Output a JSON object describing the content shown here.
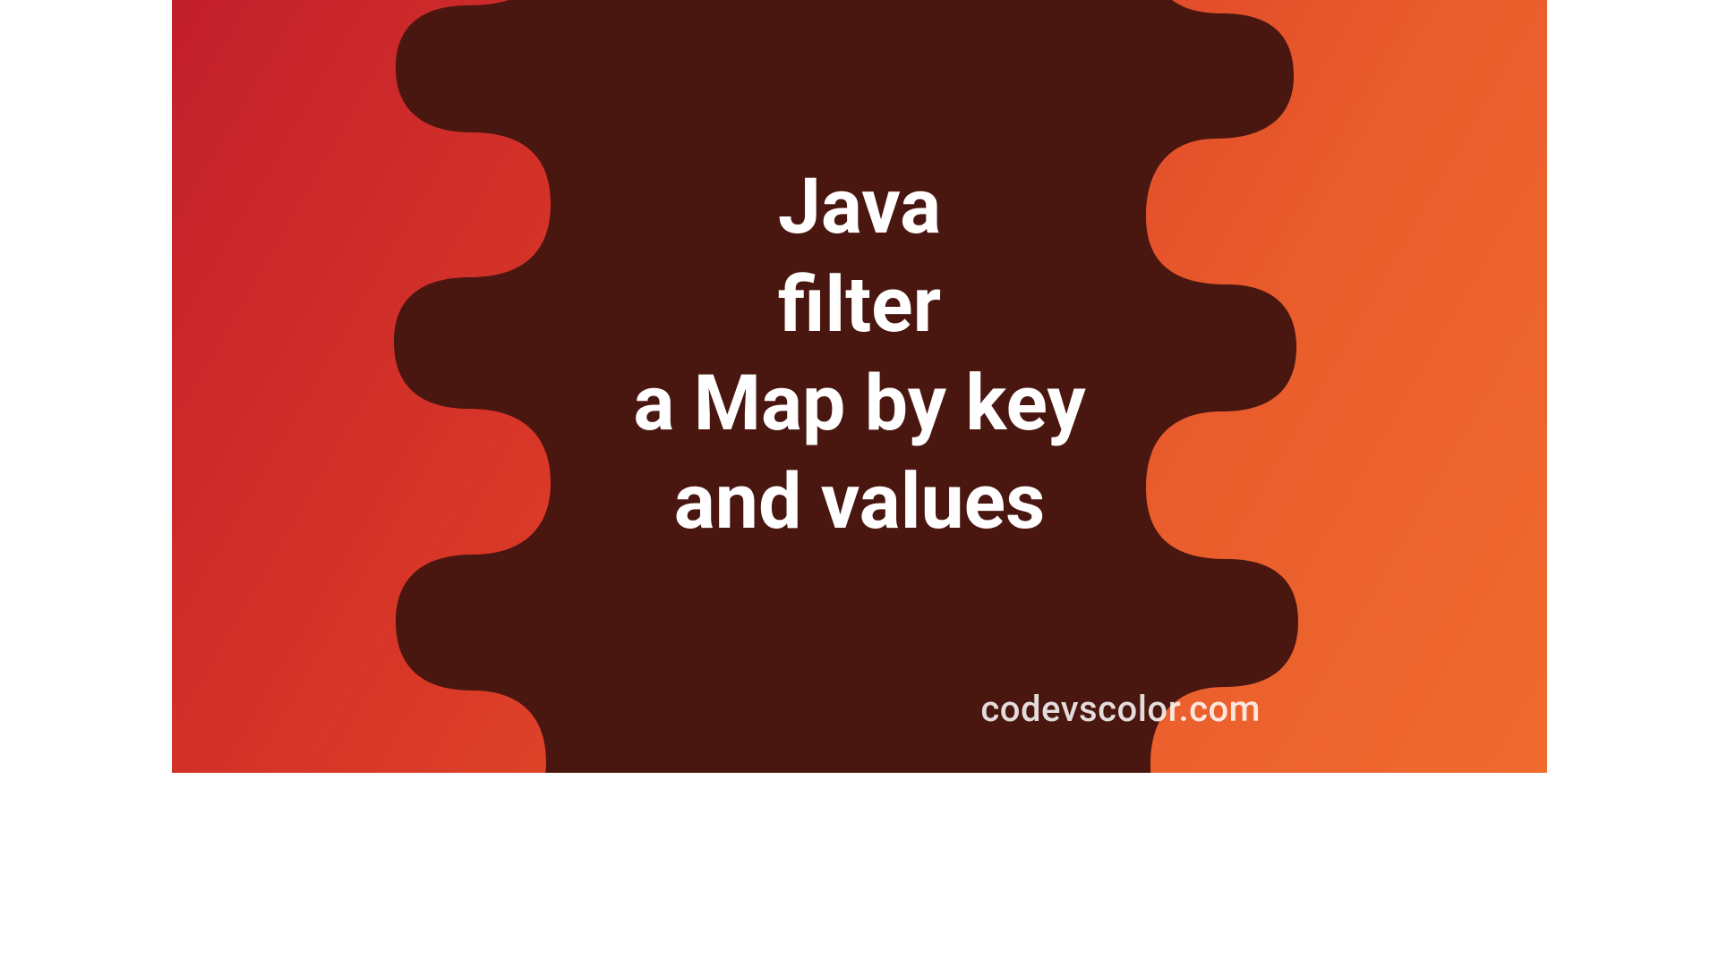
{
  "title": {
    "line1": "Java",
    "line2": "filter",
    "line3": "a Map by key",
    "line4": "and values"
  },
  "site": "codevscolor.com",
  "colors": {
    "blob": "#4a1610",
    "gradient_start": "#c21f2c",
    "gradient_end": "#f06b2f",
    "text": "#ffffff"
  }
}
